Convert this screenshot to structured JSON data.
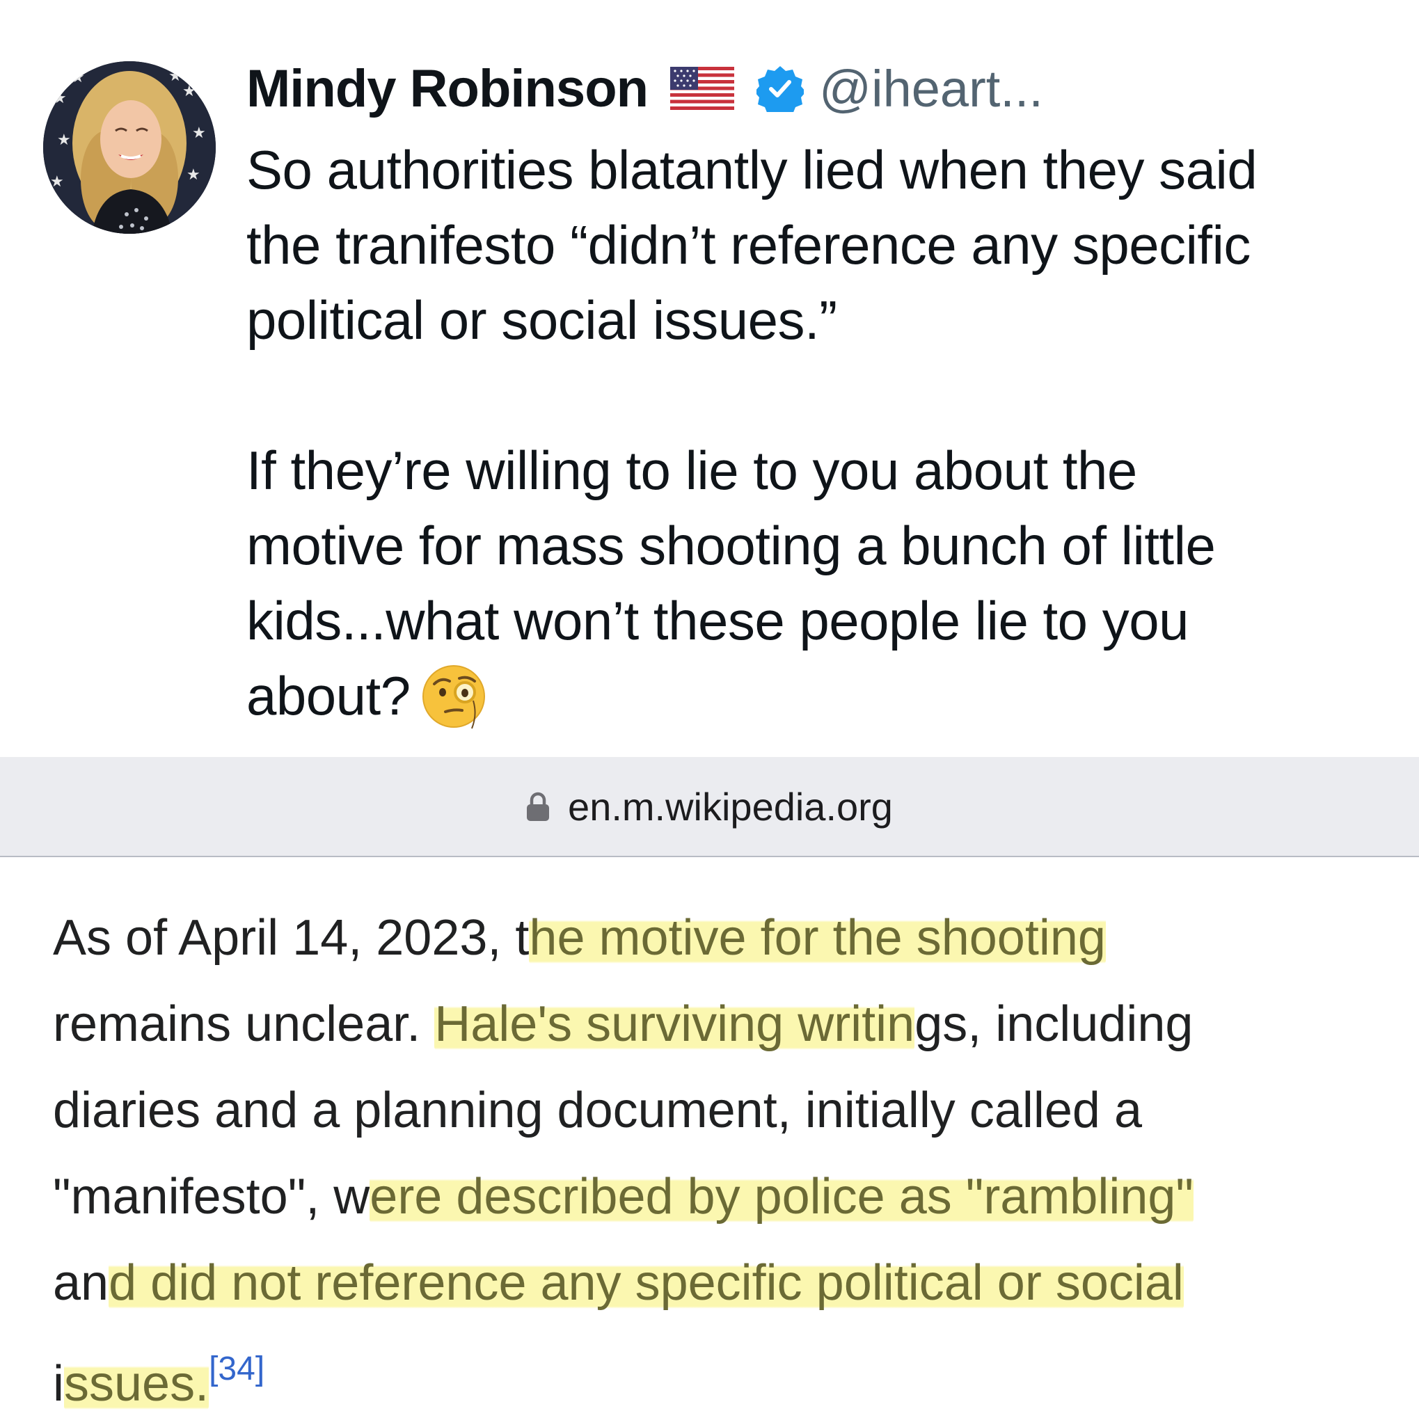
{
  "tweet": {
    "author_name": "Mindy Robinson",
    "handle": "@iheart...",
    "flag_icon": "us-flag-icon",
    "verified_icon": "verified-badge-icon",
    "verified_color": "#1d9bf0",
    "paragraph1": "So authorities blatantly lied when they said\nthe tranifesto “didn’t reference any specific\npolitical or social issues.”",
    "paragraph2": "If they’re willing to lie to you about the\nmotive for mass shooting a bunch of little\nkids...what won’t these people lie to you\nabout?",
    "emoji": "face-with-monocle-emoji"
  },
  "url_bar": {
    "lock_icon": "lock-icon",
    "url": "en.m.wikipedia.org"
  },
  "wiki": {
    "highlight_color": "#faf496",
    "line1_a": "As of April 14, 2023, t",
    "line1_b": "he motive for the shooting",
    "line2_a": "remains unclear. ",
    "line2_b": "Hale's surviving writin",
    "line2_c": "gs, including",
    "line3": "diaries and a planning document, initially called a",
    "line4_a": "\"manifesto\", w",
    "line4_b": "ere described by police as \"rambling\"",
    "line5_a": "an",
    "line5_b": "d did not reference any specific political or social",
    "line6_a": "i",
    "line6_b": "ssues.",
    "citation": "[34]"
  }
}
